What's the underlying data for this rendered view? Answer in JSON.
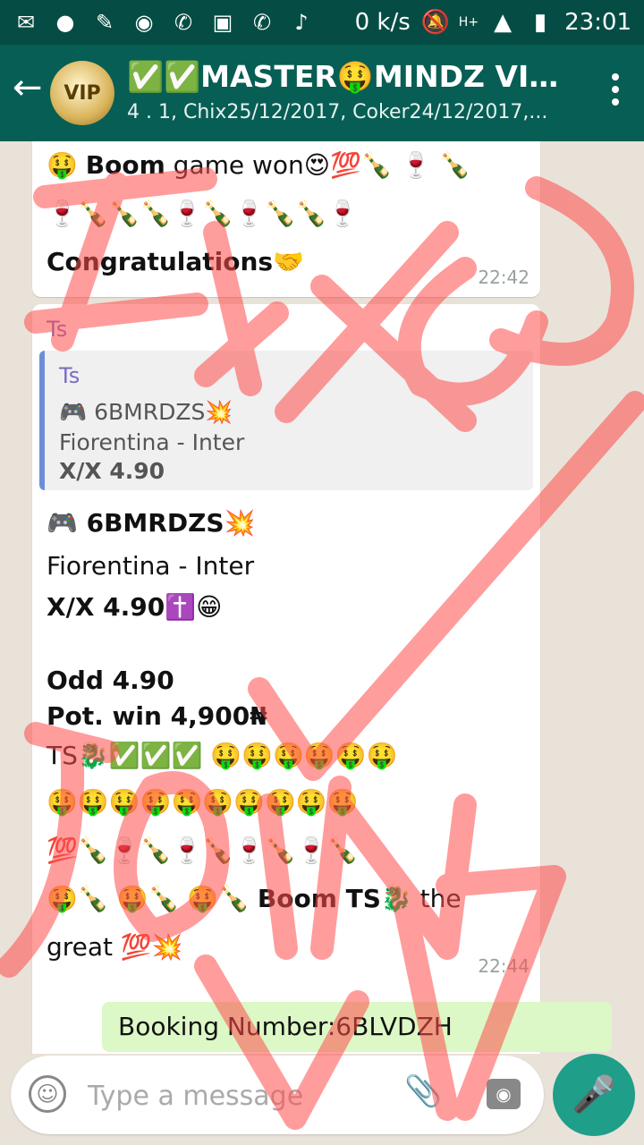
{
  "status_bar": {
    "speed": "0 k/s",
    "network": "H+",
    "time": "23:01",
    "icons": [
      "gmail-icon",
      "circle-icon",
      "pen-icon",
      "messenger-icon",
      "whatsapp-icon",
      "image-icon",
      "whatsapp-icon",
      "music-icon",
      "mute-icon",
      "signal-icon",
      "battery-icon"
    ]
  },
  "header": {
    "back_icon": "arrow-left-icon",
    "avatar_text": "VIP",
    "title": "✅✅MASTER🤑MINDZ VIP'...",
    "subtitle": "4 . 1, Chix25/12/2017, Coker24/12/2017,...",
    "menu_icon": "more-vert-icon"
  },
  "messages": {
    "m1": {
      "line1_prefix": "🤑 ",
      "line1_bold": "Boom",
      "line1_rest": " game won😍💯🍾 🍷 🍾",
      "line2": "🍷🍾🍾🍾🍷🍾🍷🍾🍾🍷",
      "line3": "Congratulations🤝",
      "time": "22:42"
    },
    "m2": {
      "sender": "Ts",
      "quote_sender": "Ts",
      "quote_line1": "🎮 6BMRDZS💥",
      "quote_line2": "Fiorentina - Inter",
      "quote_line3": "X/X 4.90",
      "line1": "🎮 6BMRDZS💥",
      "line2": "Fiorentina - Inter",
      "line3": "X/X 4.90✝️😁",
      "line4": "Odd 4.90",
      "line5": "Pot. win 4,900₦",
      "line6": "TS🐉✅✅✅ 🤑🤑🤑🤑🤑🤑",
      "line7": "🤑🤑🤑🤑🤑🤑🤑🤑🤑🤑",
      "line8": "💯🍾🍷🍾🍷🍾🍷🍾🍷🍾",
      "line9_prefix": "🤑🍾 🤑🍾 🤑🍾 ",
      "line9_bold": "Boom TS",
      "line9_rest": "🐉 the",
      "line10": "great 💯💥",
      "time": "22:44"
    },
    "m3": {
      "text": "Booking Number:6BLVDZH"
    }
  },
  "composer": {
    "placeholder": "Type a message",
    "emoji_icon": "emoji-icon",
    "attach_icon": "paperclip-icon",
    "camera_icon": "camera-icon",
    "mic_icon": "mic-icon"
  },
  "overlay": {
    "color": "#ff4d4d",
    "handwriting_top": "FIXED",
    "handwriting_bottom": "JOIN"
  }
}
